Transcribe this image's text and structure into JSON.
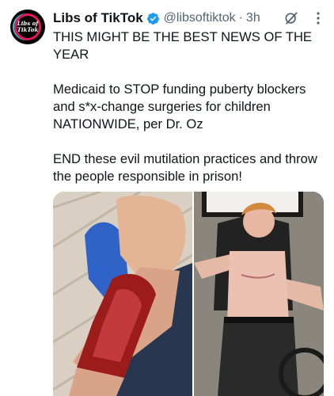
{
  "post": {
    "avatar": {
      "text_line1": "Libs of",
      "text_line2": "TikTok"
    },
    "author": {
      "display_name": "Libs of TikTok",
      "handle": "@libsoftiktok",
      "separator": "·",
      "time": "3h",
      "verified_color": "#1d9bf0"
    },
    "text": {
      "para1": "THIS MIGHT BE THE BEST NEWS OF THE YEAR",
      "para2": "Medicaid to STOP funding puberty blockers and s*x-change surgeries for children NATIONWIDE, per Dr. Oz",
      "para3": "END these evil mutilation practices and throw the people responsible in prison!"
    },
    "icons": {
      "verified": "verified-badge-icon",
      "grok": "grok-icon",
      "more": "more-options-icon"
    },
    "media": {
      "count": 2,
      "items": [
        "photo-left",
        "photo-right"
      ]
    }
  }
}
